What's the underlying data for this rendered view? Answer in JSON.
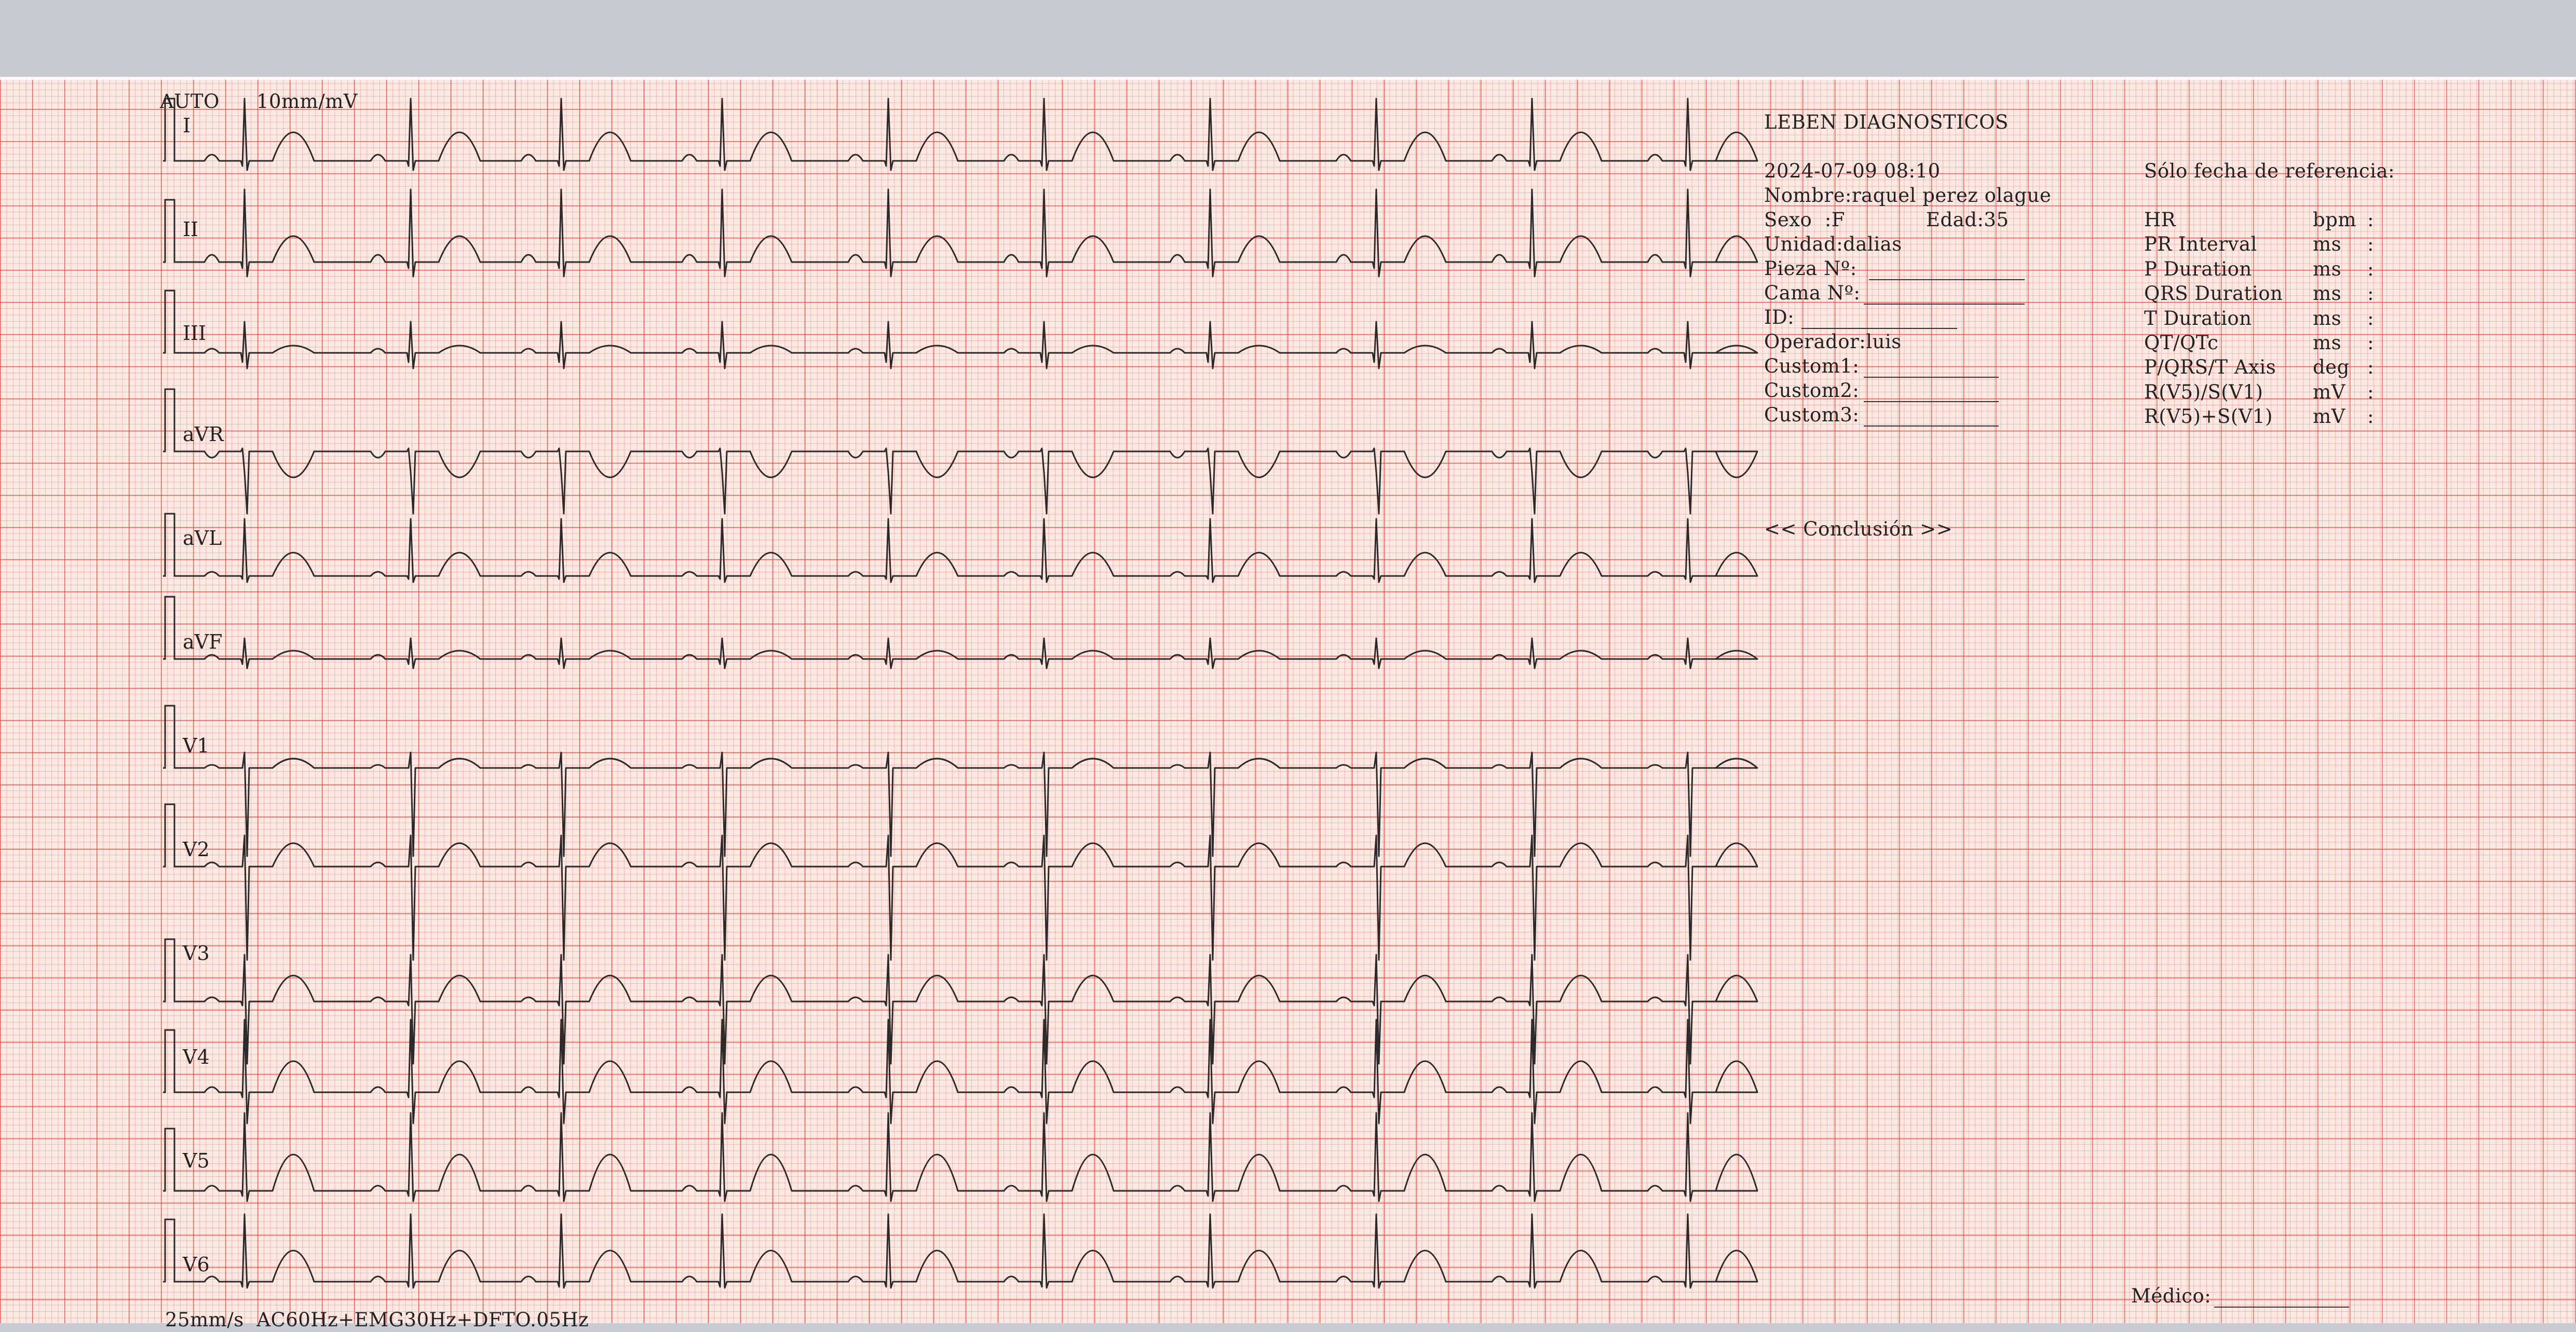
{
  "header": {
    "mode": "AUTO",
    "gain": "10mm/mV",
    "footer": "25mm/s  AC60Hz+EMG30Hz+DFTO.05Hz"
  },
  "leads": [
    "I",
    "II",
    "III",
    "aVR",
    "aVL",
    "aVF",
    "V1",
    "V2",
    "V3",
    "V4",
    "V5",
    "V6"
  ],
  "patient": {
    "institution": "LEBEN DIAGNOSTICOS",
    "datetime": "2024-07-09 08:10",
    "nombre": "Nombre:raquel perez olague",
    "sexo": "Sexo  :F",
    "edad": "Edad:35",
    "unidad": "Unidad:dalias",
    "pieza": "Pieza Nº:",
    "cama": "Cama Nº:",
    "id": "ID:",
    "operador": "Operador:luis",
    "custom1": "Custom1:",
    "custom2": "Custom2:",
    "custom3": "Custom3:"
  },
  "reference": {
    "title": "Sólo fecha de referencia:",
    "rows": [
      {
        "name": "HR",
        "unit": "bpm",
        "sep": ":"
      },
      {
        "name": "PR Interval",
        "unit": "ms",
        "sep": ":"
      },
      {
        "name": "P Duration",
        "unit": "ms",
        "sep": ":"
      },
      {
        "name": "QRS Duration",
        "unit": "ms",
        "sep": ":"
      },
      {
        "name": "T Duration",
        "unit": "ms",
        "sep": ":"
      },
      {
        "name": "QT/QTc",
        "unit": "ms",
        "sep": ":"
      },
      {
        "name": "P/QRS/T Axis",
        "unit": "deg",
        "sep": ":"
      },
      {
        "name": "R(V5)/S(V1)",
        "unit": "mV",
        "sep": ":"
      },
      {
        "name": "R(V5)+S(V1)",
        "unit": "mV",
        "sep": ":"
      }
    ]
  },
  "conclusion": "<< Conclusión >>",
  "medico": "Médico:",
  "colors": {
    "trace": "#2a2a2a",
    "grid_major": "#d6463c",
    "grid_minor": "#e8786e",
    "paper": "#fbe9e3"
  }
}
